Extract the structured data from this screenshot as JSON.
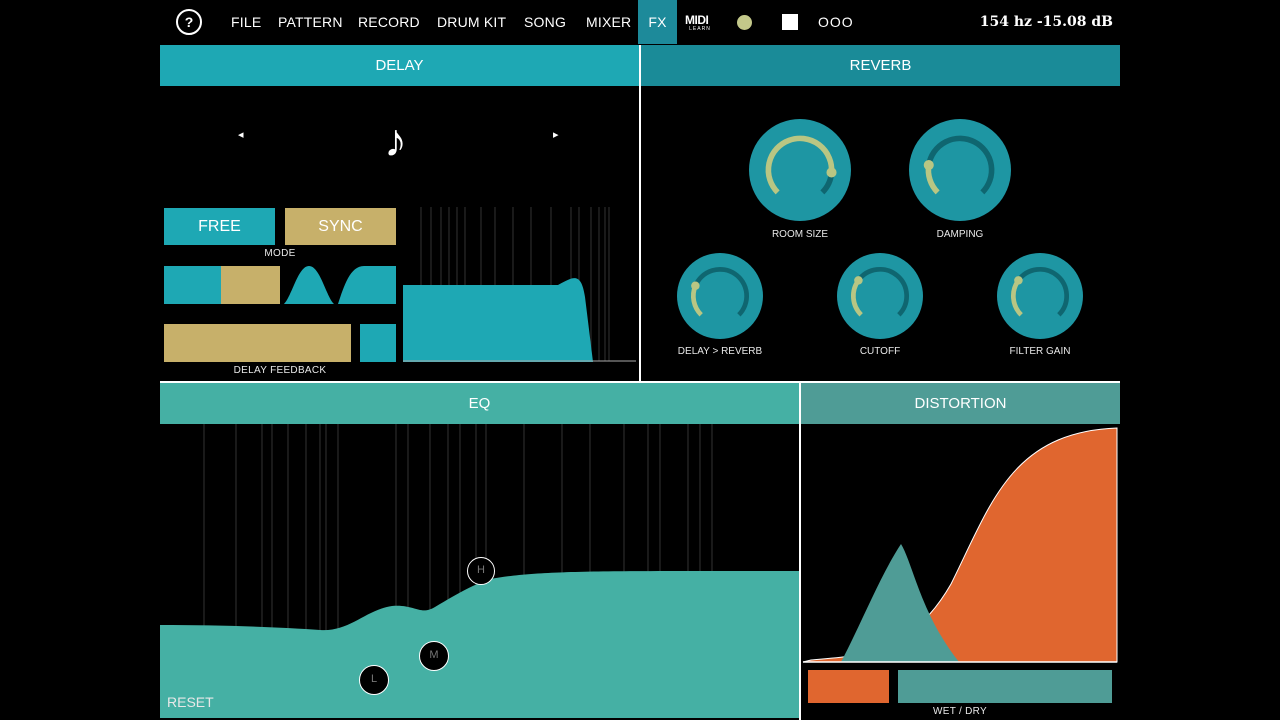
{
  "topbar": {
    "help_label": "?",
    "menu": [
      {
        "label": "FILE"
      },
      {
        "label": "PATTERN"
      },
      {
        "label": "RECORD"
      },
      {
        "label": "DRUM KIT"
      },
      {
        "label": "SONG"
      },
      {
        "label": "MIXER"
      },
      {
        "label": "FX",
        "active": true
      }
    ],
    "midi_big": "MIDI",
    "midi_small": "LEARN",
    "more_label": "OOO",
    "readout": "154 hz  -15.08 dB"
  },
  "delay": {
    "title": "DELAY",
    "prev_arrow": "◂",
    "next_arrow": "▸",
    "note_glyph": "♪",
    "mode_free": "FREE",
    "mode_sync": "SYNC",
    "mode_label": "MODE",
    "feedback_label": "DELAY FEEDBACK"
  },
  "reverb": {
    "title": "REVERB",
    "knobs": [
      {
        "label": "ROOM SIZE",
        "value": 0.85
      },
      {
        "label": "DAMPING",
        "value": 0.2
      },
      {
        "label": "DELAY > REVERB",
        "value": 0.25
      },
      {
        "label": "CUTOFF",
        "value": 0.3
      },
      {
        "label": "FILTER GAIN",
        "value": 0.3
      }
    ]
  },
  "eq": {
    "title": "EQ",
    "reset_label": "RESET",
    "handle_low": "L",
    "handle_mid": "M",
    "handle_high": "H"
  },
  "distortion": {
    "title": "DISTORTION",
    "wetdry_label": "WET / DRY"
  },
  "colors": {
    "teal": "#1ea8b4",
    "teal_dark": "#1a8b98",
    "teal_knob": "#1e96a3",
    "gold": "#c7b06a",
    "eq_teal": "#45b0a4",
    "dist_orange": "#e0662f",
    "dist_teal": "#4f9c96"
  }
}
